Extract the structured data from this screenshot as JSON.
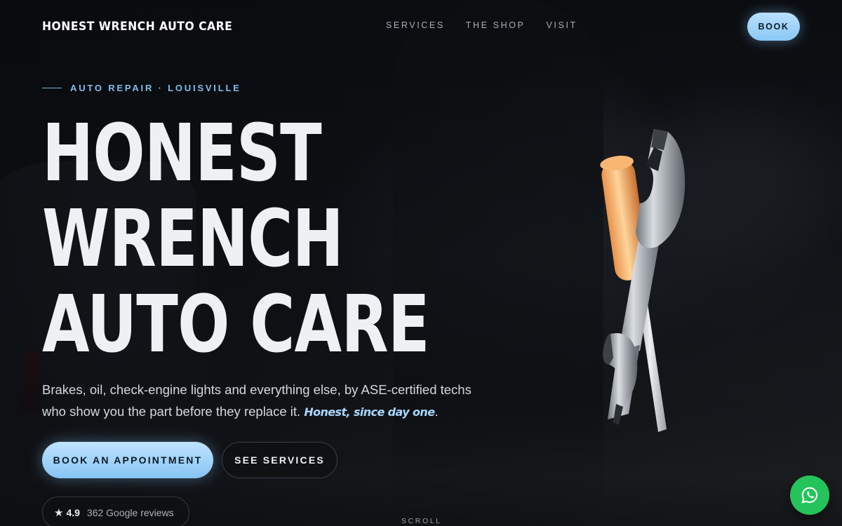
{
  "brand": {
    "logo_text": "HONEST WRENCH AUTO CARE"
  },
  "nav": {
    "links": [
      {
        "label": "SERVICES"
      },
      {
        "label": "THE SHOP"
      },
      {
        "label": "VISIT"
      }
    ],
    "book_label": "BOOK"
  },
  "hero": {
    "eyebrow": "AUTO REPAIR · LOUISVILLE",
    "headline_lines": [
      "HONEST",
      "WRENCH",
      "AUTO CARE"
    ],
    "subtitle": "Brakes, oil, check-engine lights and everything else, by ASE-certified techs who show you the part before they replace it. ",
    "subtitle_emphasis": "Honest, since day one",
    "subtitle_end": ".",
    "primary_cta": "BOOK AN APPOINTMENT",
    "secondary_cta": "SEE SERVICES",
    "reviews": {
      "rating": "4.9",
      "count_text": "362 Google reviews",
      "icon": "star-icon"
    },
    "scroll_label": "SCROLL"
  },
  "icons": {
    "whatsapp": "whatsapp-icon",
    "illustration": "wrench-screwdriver-illustration"
  },
  "colors": {
    "accent": "#8ac8f5",
    "whatsapp": "#25c45a",
    "background": "#0b0d10"
  }
}
